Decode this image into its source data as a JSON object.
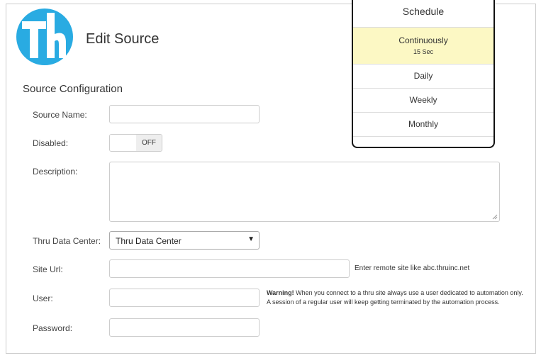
{
  "header": {
    "title": "Edit Source"
  },
  "section": {
    "title": "Source Configuration"
  },
  "form": {
    "source_name_label": "Source Name:",
    "disabled_label": "Disabled:",
    "toggle_state": "OFF",
    "description_label": "Description:",
    "data_center_label": "Thru Data Center:",
    "data_center_value": "Thru Data Center",
    "site_url_label": "Site Url:",
    "site_url_hint": "Enter remote site like abc.thruinc.net",
    "user_label": "User:",
    "warning_bold": "Warning!",
    "warning_line1": " When you connect to a thru site always use a user dedicated to automation only.",
    "warning_line2": "A session of a regular user will keep getting terminated by the automation process.",
    "password_label": "Password:"
  },
  "schedule": {
    "title": "Schedule",
    "items": [
      {
        "label": "Continuously",
        "sub": "15 Sec",
        "selected": true
      },
      {
        "label": "Daily"
      },
      {
        "label": "Weekly"
      },
      {
        "label": "Monthly"
      }
    ]
  },
  "colors": {
    "brand": "#29abe2",
    "selected_bg": "#fcf8c4",
    "border": "#cccccc"
  },
  "icons": {
    "logo": "thru-logo-icon"
  }
}
